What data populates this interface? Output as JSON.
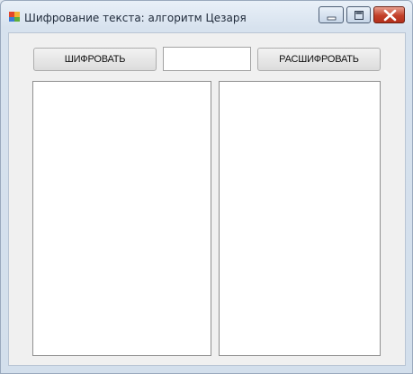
{
  "window": {
    "title": "Шифрование текста: алгоритм Цезаря"
  },
  "title_controls": {
    "minimize_icon": "minimize-icon",
    "maximize_icon": "maximize-icon",
    "close_icon": "close-icon"
  },
  "toolbar": {
    "encrypt_label": "ШИФРОВАТЬ",
    "key_value": "",
    "decrypt_label": "РАСШИФРОВАТЬ"
  },
  "text_areas": {
    "source_text": "",
    "result_text": ""
  },
  "colors": {
    "close_button": "#c2402a",
    "client_background": "#f0f0f0"
  }
}
